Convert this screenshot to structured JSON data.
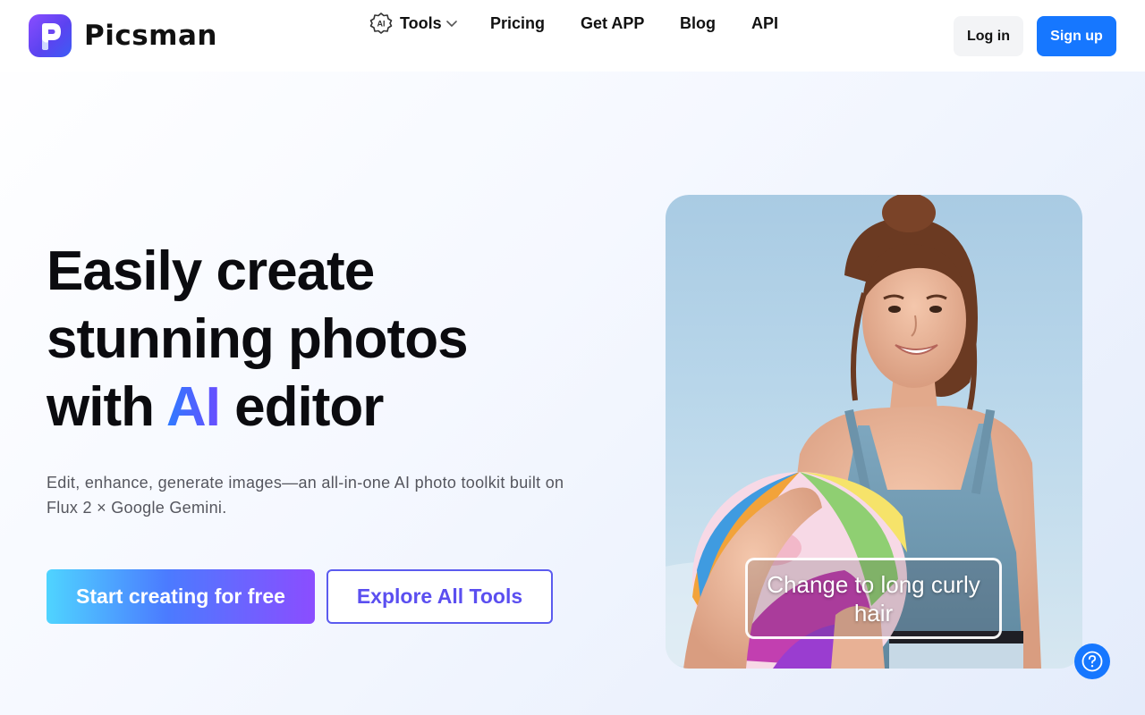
{
  "brand": {
    "name": "Picsman"
  },
  "nav": {
    "tools": "Tools",
    "pricing": "Pricing",
    "get_app": "Get APP",
    "blog": "Blog",
    "api": "API"
  },
  "auth": {
    "login": "Log in",
    "signup": "Sign up"
  },
  "hero": {
    "title_line1": "Easily create",
    "title_line2": "stunning photos",
    "title_line3_pre": "with ",
    "title_line3_ai": "AI",
    "title_line3_post": " editor",
    "subtitle": "Edit, enhance, generate images—an all-in-one AI photo toolkit built on Flux 2 × Google Gemini.",
    "cta_primary": "Start creating for free",
    "cta_secondary": "Explore All Tools"
  },
  "showcase": {
    "caption": "Change to long curly hair"
  },
  "icons": {
    "logo": "picsman-logo-icon",
    "tools": "ai-chip-icon",
    "dropdown": "chevron-down-icon",
    "help": "question-icon"
  },
  "colors": {
    "brand_blue": "#1677ff",
    "accent_purple": "#5b4ff0",
    "ai_gradient_start": "#2f7bff",
    "ai_gradient_end": "#6a4dff"
  }
}
